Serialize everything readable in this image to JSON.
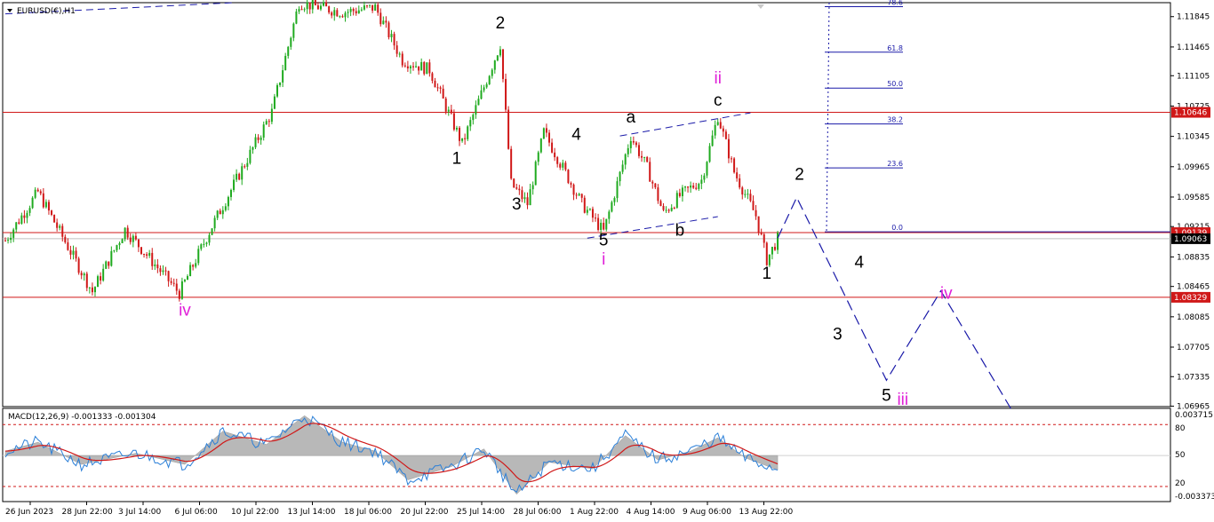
{
  "window": {
    "symbol_title": "EURUSD(€),H1",
    "indicator_title": "MACD(12,26,9) -0.001333 -0.001304"
  },
  "colors": {
    "bull": "#1faa1f",
    "bear": "#d01818",
    "support_resistance": "#d01818",
    "projection": "#1a1aa8",
    "fib": "#1a1aa8",
    "wave_primary": "#000000",
    "wave_secondary": "#e020d8",
    "macd_hist": "#b8b8b8",
    "macd_line": "#2a7fd8",
    "macd_signal": "#d01818"
  },
  "price_axis": {
    "min": 1.0696,
    "max": 1.1202,
    "ticks": [
      "1.11845",
      "1.11465",
      "1.11105",
      "1.10725",
      "1.10345",
      "1.09965",
      "1.09585",
      "1.09215",
      "1.08835",
      "1.08465",
      "1.08085",
      "1.07705",
      "1.07335",
      "1.06965"
    ],
    "tags": [
      {
        "text": "1.10646",
        "value": 1.10646,
        "color": "#d01818"
      },
      {
        "text": "1.09139",
        "value": 1.09139,
        "color": "#d01818"
      },
      {
        "text": "1.09063",
        "value": 1.09063,
        "color": "#000000"
      },
      {
        "text": "1.08329",
        "value": 1.08329,
        "color": "#d01818"
      }
    ]
  },
  "macd_axis": {
    "min": -0.004,
    "max": 0.0041,
    "ticks": [
      "0.003715",
      "80",
      "50",
      "20",
      "-0.003373"
    ]
  },
  "time_axis": {
    "labels": [
      "26 Jun 2023",
      "28 Jun 22:00",
      "3 Jul 14:00",
      "6 Jul 06:00",
      "10 Jul 22:00",
      "13 Jul 14:00",
      "18 Jul 06:00",
      "20 Jul 22:00",
      "25 Jul 14:00",
      "28 Jul 06:00",
      "1 Aug 22:00",
      "4 Aug 14:00",
      "9 Aug 06:00",
      "13 Aug 22:00"
    ],
    "bars": 170
  },
  "levels": [
    {
      "name": "resistance",
      "value": 1.10646
    },
    {
      "name": "support-upper",
      "value": 1.09139
    },
    {
      "name": "support-lower",
      "value": 1.08329
    }
  ],
  "fibonacci": {
    "levels": [
      {
        "label": "78.6",
        "value": 1.1197
      },
      {
        "label": "61.8",
        "value": 1.114
      },
      {
        "label": "50.0",
        "value": 1.1095
      },
      {
        "label": "38.2",
        "value": 1.105
      },
      {
        "label": "23.6",
        "value": 0.0,
        "use": 1.0995
      },
      {
        "label": "0.0",
        "value": 1.0915
      }
    ]
  },
  "wave_labels": [
    {
      "text": "2",
      "bar": 91,
      "price": 1.117,
      "style": "blk"
    },
    {
      "text": "1",
      "bar": 83,
      "price": 1.1,
      "style": "blk"
    },
    {
      "text": "3",
      "bar": 94,
      "price": 1.0943,
      "style": "blk"
    },
    {
      "text": "4",
      "bar": 105,
      "price": 1.103,
      "style": "blk"
    },
    {
      "text": "a",
      "bar": 115,
      "price": 1.1052,
      "style": "blk"
    },
    {
      "text": "5",
      "bar": 110,
      "price": 1.0898,
      "style": "blk"
    },
    {
      "text": "i",
      "bar": 110,
      "price": 1.0874,
      "style": "mag"
    },
    {
      "text": "b",
      "bar": 124,
      "price": 1.091,
      "style": "blk"
    },
    {
      "text": "c",
      "bar": 131,
      "price": 1.1073,
      "style": "blk"
    },
    {
      "text": "ii",
      "bar": 131,
      "price": 1.1101,
      "style": "mag"
    },
    {
      "text": "iv",
      "bar": 33,
      "price": 1.081,
      "style": "mag"
    },
    {
      "text": "1",
      "bar": 140,
      "price": 1.0856,
      "style": "blk"
    },
    {
      "text": "2",
      "bar": 146,
      "price": 1.098,
      "style": "blk"
    },
    {
      "text": "4",
      "bar": 157,
      "price": 1.087,
      "style": "blk"
    },
    {
      "text": "3",
      "bar": 153,
      "price": 1.078,
      "style": "blk"
    },
    {
      "text": "5",
      "bar": 162,
      "price": 1.0703,
      "style": "blk"
    },
    {
      "text": "iii",
      "bar": 165,
      "price": 1.0698,
      "style": "mag"
    },
    {
      "text": "iv",
      "bar": 173,
      "price": 1.0831,
      "style": "mag"
    }
  ],
  "projection_path": [
    {
      "bar": 142,
      "price": 1.0907
    },
    {
      "bar": 145.5,
      "price": 1.0958
    },
    {
      "bar": 162,
      "price": 1.0729
    },
    {
      "bar": 172,
      "price": 1.0841
    },
    {
      "bar": 185,
      "price": 1.0692
    }
  ],
  "channel_lines": [
    {
      "from": {
        "bar": 113,
        "price": 1.1035
      },
      "to": {
        "bar": 137,
        "price": 1.1064
      }
    },
    {
      "from": {
        "bar": 107,
        "price": 1.0907
      },
      "to": {
        "bar": 131,
        "price": 1.0934
      }
    }
  ],
  "trend_line": {
    "from": {
      "bar": 0,
      "price": 1.1188
    },
    "to": {
      "bar": 42,
      "price": 1.1202
    }
  },
  "chart_data": {
    "type": "line",
    "title": "EURUSD(€),H1",
    "series_anchor_prices": [
      {
        "bar": 0,
        "price": 1.0904
      },
      {
        "bar": 6,
        "price": 1.0965
      },
      {
        "bar": 16,
        "price": 1.084
      },
      {
        "bar": 22,
        "price": 1.0918
      },
      {
        "bar": 32,
        "price": 1.0838
      },
      {
        "bar": 38,
        "price": 1.0922
      },
      {
        "bar": 44,
        "price": 1.1
      },
      {
        "bar": 49,
        "price": 1.1065
      },
      {
        "bar": 54,
        "price": 1.1202
      },
      {
        "bar": 62,
        "price": 1.119
      },
      {
        "bar": 68,
        "price": 1.1196
      },
      {
        "bar": 73,
        "price": 1.113
      },
      {
        "bar": 78,
        "price": 1.1118
      },
      {
        "bar": 84,
        "price": 1.1025
      },
      {
        "bar": 91,
        "price": 1.115
      },
      {
        "bar": 93,
        "price": 1.0975
      },
      {
        "bar": 96,
        "price": 1.095
      },
      {
        "bar": 99,
        "price": 1.104
      },
      {
        "bar": 106,
        "price": 1.095
      },
      {
        "bar": 110,
        "price": 1.0915
      },
      {
        "bar": 115,
        "price": 1.1035
      },
      {
        "bar": 118,
        "price": 1.0995
      },
      {
        "bar": 121,
        "price": 1.0938
      },
      {
        "bar": 124,
        "price": 1.096
      },
      {
        "bar": 128,
        "price": 1.098
      },
      {
        "bar": 131,
        "price": 1.106
      },
      {
        "bar": 134,
        "price": 1.099
      },
      {
        "bar": 138,
        "price": 1.0935
      },
      {
        "bar": 140,
        "price": 1.088
      },
      {
        "bar": 142,
        "price": 1.0906
      }
    ],
    "macd_anchor_values": [
      {
        "bar": 0,
        "value": 0.0004
      },
      {
        "bar": 6,
        "value": 0.0012
      },
      {
        "bar": 14,
        "value": -0.0008
      },
      {
        "bar": 24,
        "value": 0.0002
      },
      {
        "bar": 33,
        "value": -0.0008
      },
      {
        "bar": 40,
        "value": 0.0022
      },
      {
        "bar": 48,
        "value": 0.001
      },
      {
        "bar": 55,
        "value": 0.0036
      },
      {
        "bar": 62,
        "value": 0.0012
      },
      {
        "bar": 68,
        "value": 0.0004
      },
      {
        "bar": 74,
        "value": -0.0022
      },
      {
        "bar": 82,
        "value": -0.001
      },
      {
        "bar": 88,
        "value": 0.0006
      },
      {
        "bar": 94,
        "value": -0.0035
      },
      {
        "bar": 100,
        "value": -0.0006
      },
      {
        "bar": 108,
        "value": -0.0012
      },
      {
        "bar": 114,
        "value": 0.0018
      },
      {
        "bar": 120,
        "value": -0.0004
      },
      {
        "bar": 126,
        "value": 0.0004
      },
      {
        "bar": 131,
        "value": 0.0016
      },
      {
        "bar": 136,
        "value": -0.0002
      },
      {
        "bar": 142,
        "value": -0.0013
      }
    ],
    "ylim": [
      1.0696,
      1.1202
    ],
    "grid": false
  }
}
